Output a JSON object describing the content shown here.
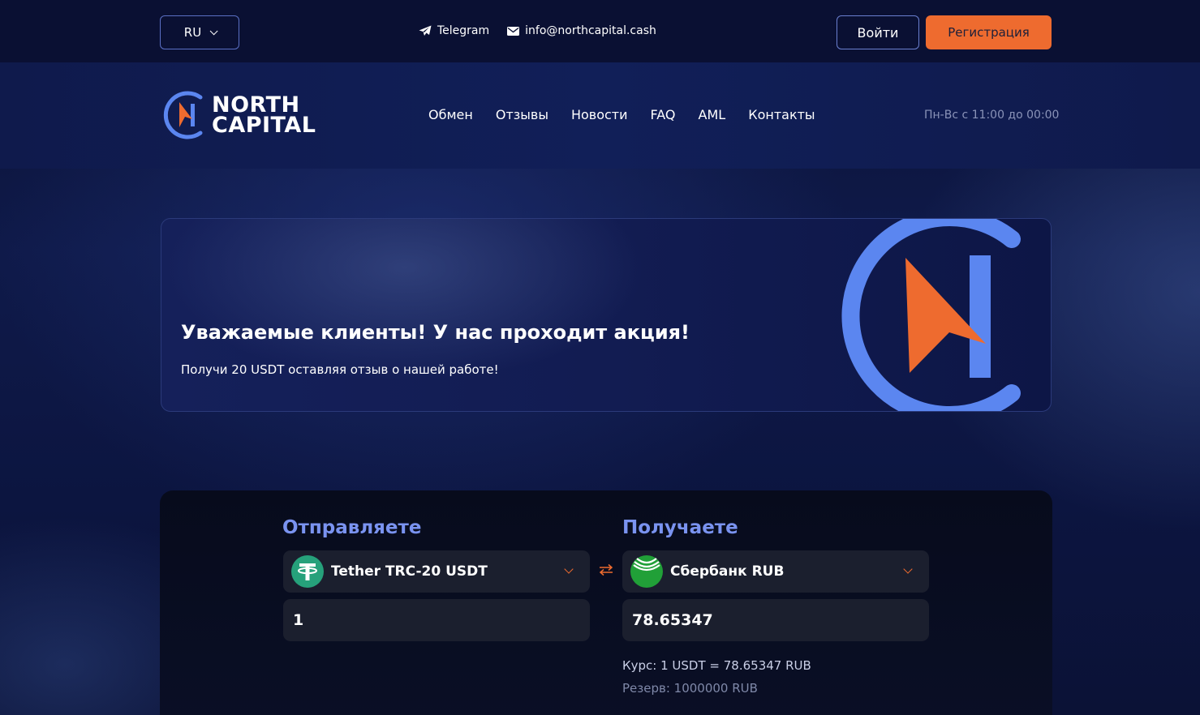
{
  "header": {
    "language": "RU",
    "telegram_label": "Telegram",
    "email": "info@northcapital.cash",
    "login_label": "Войти",
    "register_label": "Регистрация"
  },
  "brand": {
    "name_line1": "NORTH",
    "name_line2": "CAPITAL"
  },
  "nav": {
    "items": [
      "Обмен",
      "Отзывы",
      "Новости",
      "FAQ",
      "AML",
      "Контакты"
    ],
    "hours": "Пн-Вс с 11:00 до 00:00"
  },
  "banner": {
    "title": "Уважаемые клиенты! У нас проходит акция!",
    "subtitle": "Получи 20 USDT оставляя отзыв о нашей работе!"
  },
  "exchange": {
    "send_title": "Отправляете",
    "receive_title": "Получаете",
    "send_currency": "Tether TRC-20 USDT",
    "receive_currency": "Сбербанк RUB",
    "send_amount": "1",
    "receive_amount": "78.65347",
    "rate": "Курс: 1 USDT = 78.65347 RUB",
    "reserve": "Резерв: 1000000 RUB"
  },
  "colors": {
    "accent_orange": "#ee6b2f",
    "accent_blue": "#5b86f0",
    "tether_green": "#26a17b",
    "sber_green": "#21a038"
  }
}
